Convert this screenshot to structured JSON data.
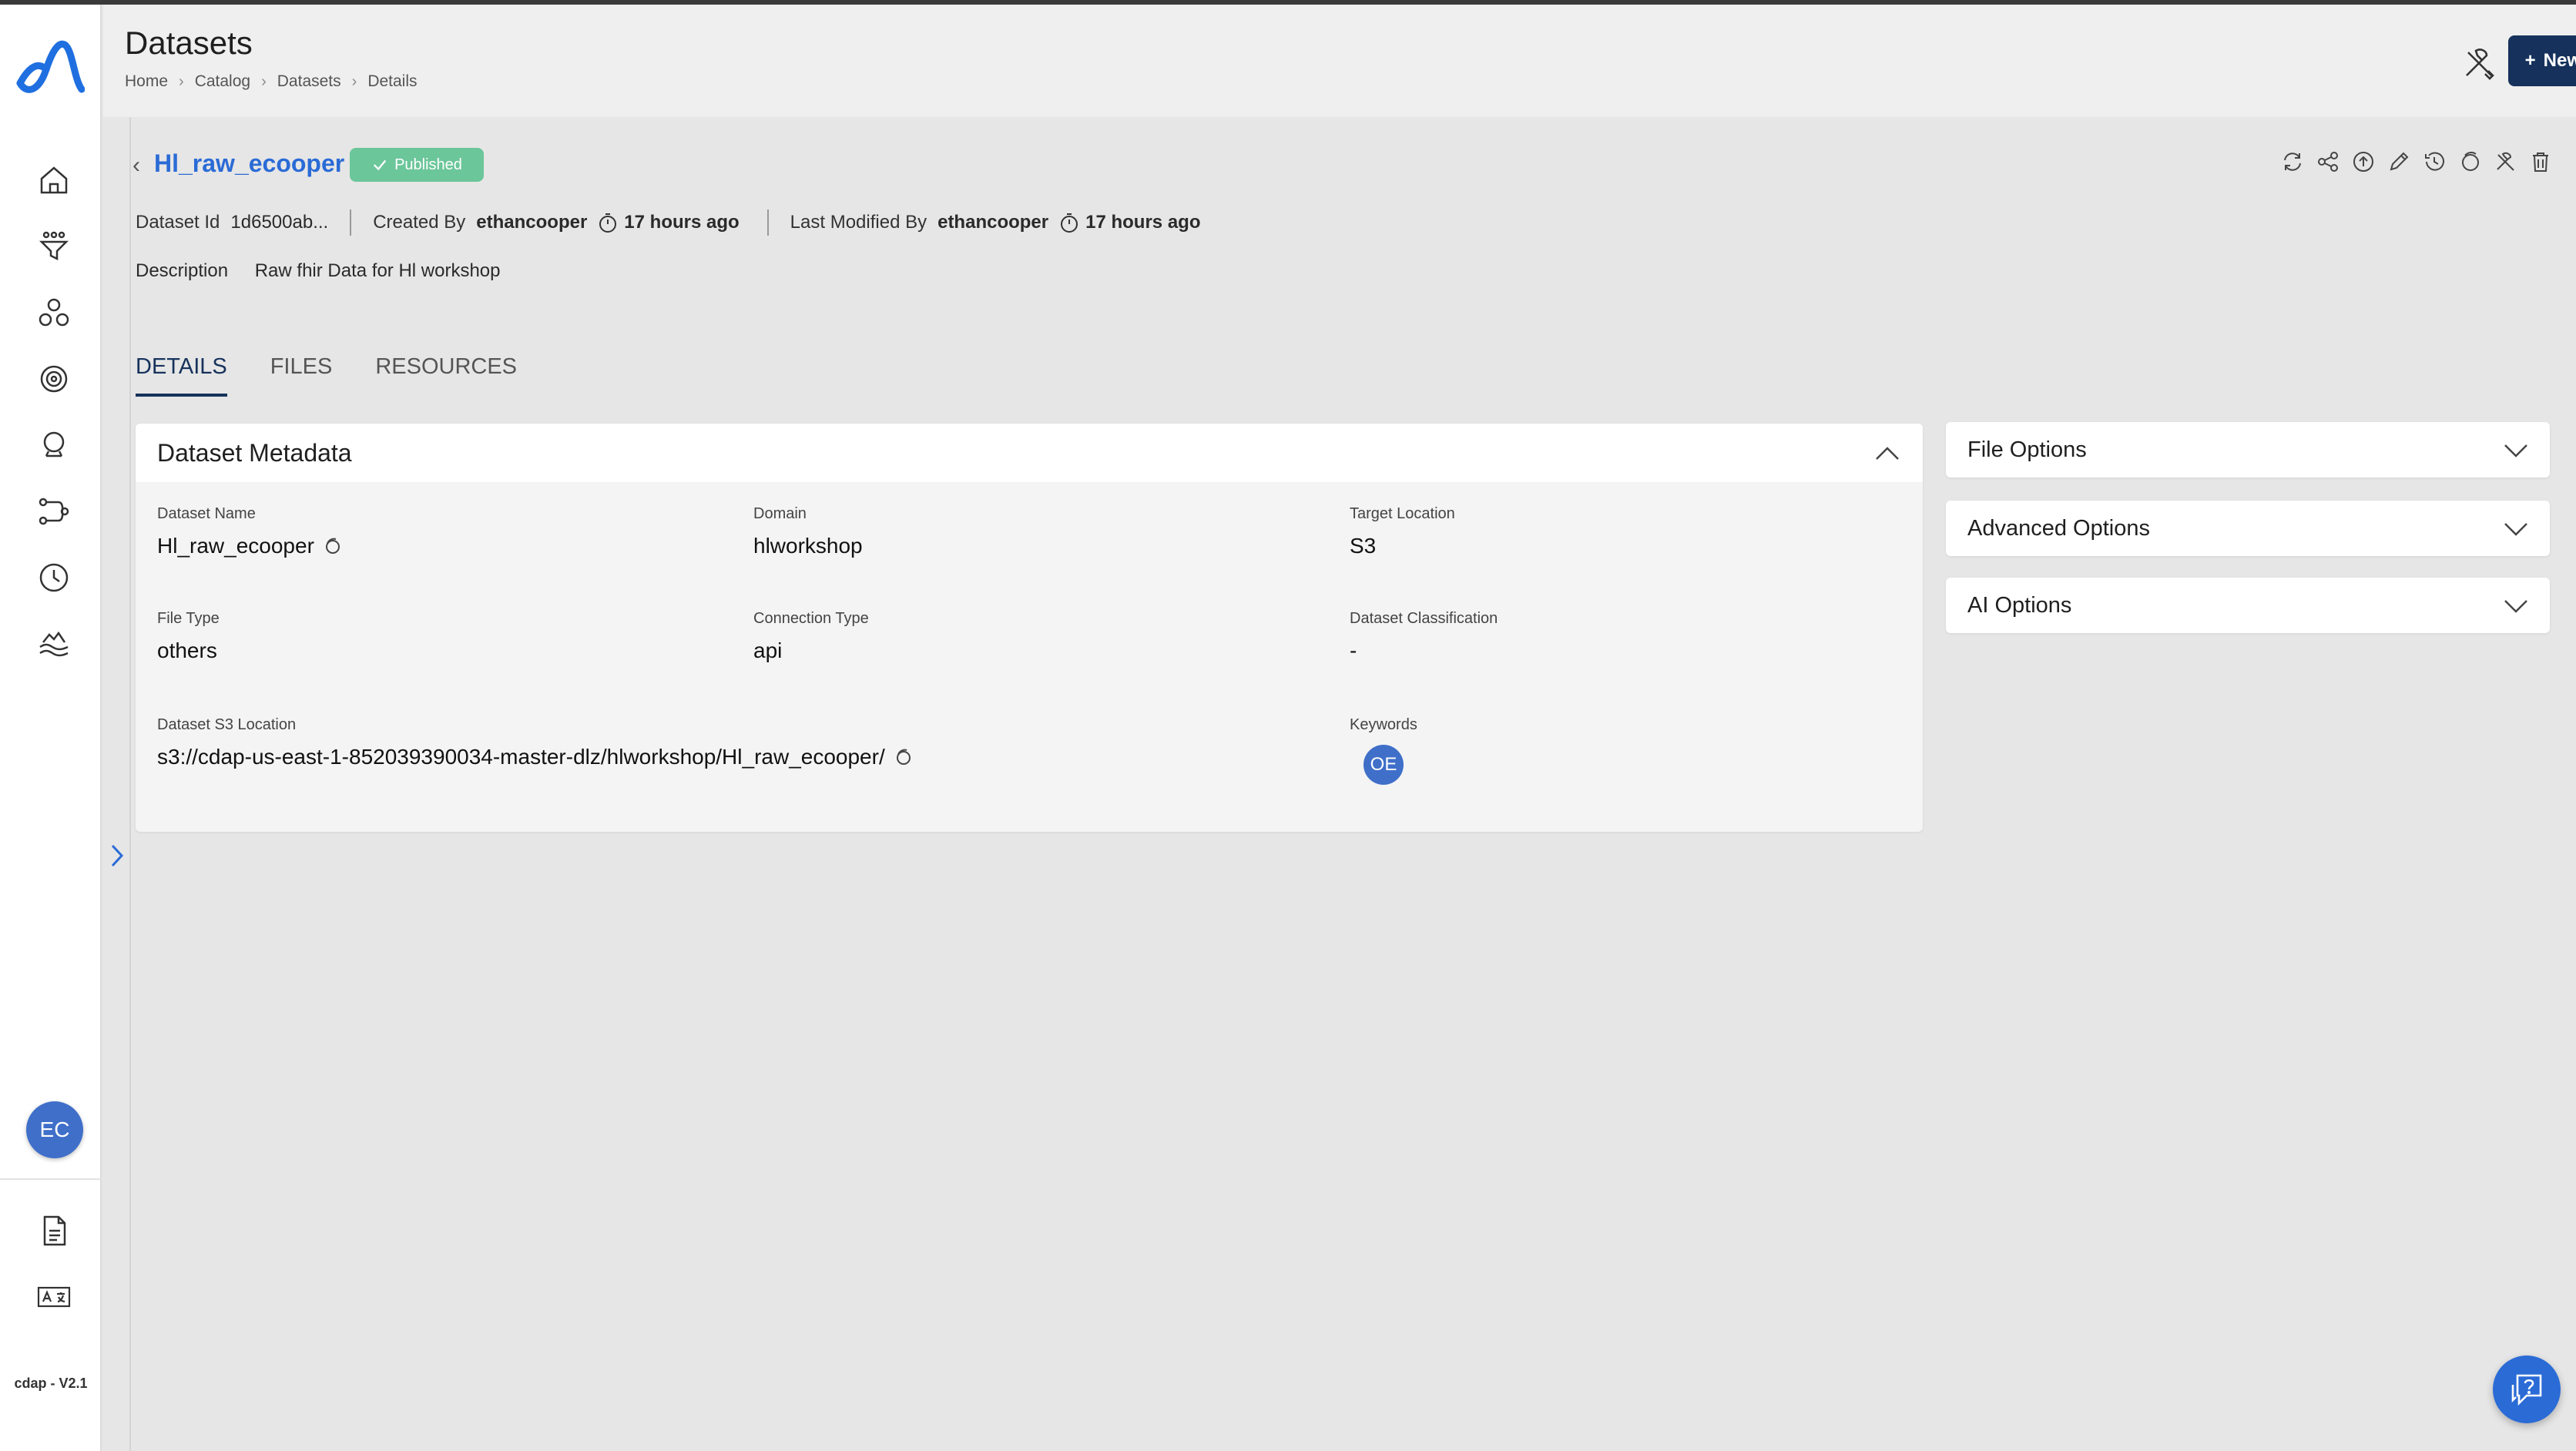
{
  "header": {
    "title": "Datasets",
    "breadcrumb": [
      "Home",
      "Catalog",
      "Datasets",
      "Details"
    ],
    "new_button_label": "New Dataset"
  },
  "sidebar": {
    "avatar_initials": "EC",
    "version": "cdap - V2.1",
    "nav_icons": [
      "home-icon",
      "filter-funnel-icon",
      "nodes-icon",
      "target-icon",
      "brain-icon",
      "pipeline-icon",
      "clock-icon",
      "data-lake-icon"
    ],
    "bottom_icons": [
      "document-icon",
      "translate-icon"
    ]
  },
  "dataset": {
    "name": "Hl_raw_ecooper",
    "status": "Published",
    "id_label": "Dataset Id",
    "id_value": "1d6500ab...",
    "created_by_label": "Created By",
    "created_by": "ethancooper",
    "created_ago": "17 hours ago",
    "modified_by_label": "Last Modified By",
    "modified_by": "ethancooper",
    "modified_ago": "17 hours ago",
    "description_label": "Description",
    "description": "Raw fhir Data for Hl workshop"
  },
  "tabs": [
    {
      "label": "DETAILS",
      "active": true
    },
    {
      "label": "FILES",
      "active": false
    },
    {
      "label": "RESOURCES",
      "active": false
    }
  ],
  "metadata": {
    "title": "Dataset Metadata",
    "fields": {
      "dataset_name": {
        "label": "Dataset Name",
        "value": "Hl_raw_ecooper"
      },
      "domain": {
        "label": "Domain",
        "value": "hlworkshop"
      },
      "target_location": {
        "label": "Target Location",
        "value": "S3"
      },
      "file_type": {
        "label": "File Type",
        "value": "others"
      },
      "connection_type": {
        "label": "Connection Type",
        "value": "api"
      },
      "classification": {
        "label": "Dataset Classification",
        "value": "-"
      },
      "s3_location": {
        "label": "Dataset S3 Location",
        "value": "s3://cdap-us-east-1-852039390034-master-dlz/hlworkshop/Hl_raw_ecooper/"
      },
      "keywords": {
        "label": "Keywords",
        "value": "OE"
      }
    }
  },
  "accordions": [
    {
      "label": "File Options"
    },
    {
      "label": "Advanced Options"
    },
    {
      "label": "AI Options"
    }
  ],
  "colors": {
    "brand": "#16325c",
    "link": "#2a6bd6",
    "published": "#6bc69a",
    "avatar": "#3f6fc9"
  }
}
